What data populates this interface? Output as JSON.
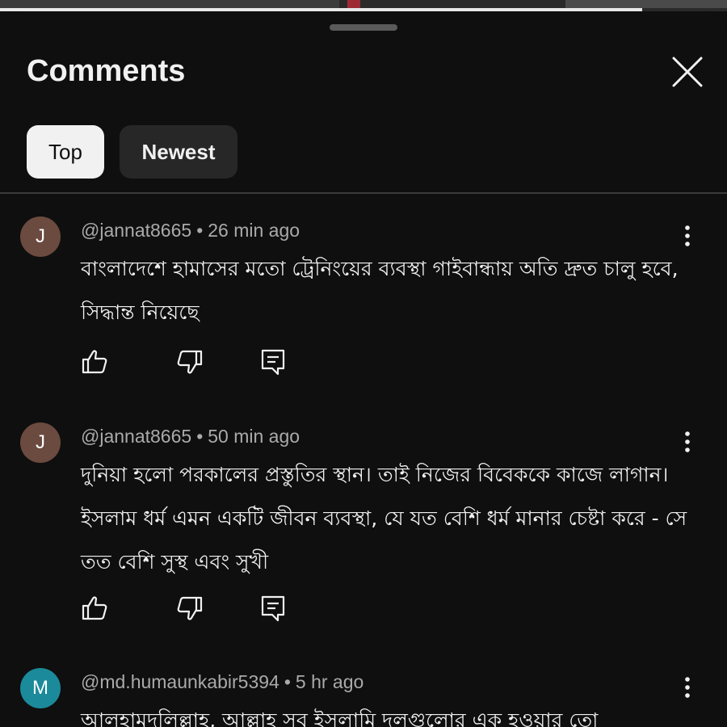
{
  "header": {
    "title": "Comments",
    "close_icon": "close-icon"
  },
  "sort": {
    "top_label": "Top",
    "newest_label": "Newest",
    "selected": "Top"
  },
  "colors": {
    "background": "#0f0f0f",
    "text": "#f1f1f1",
    "meta": "#aaaaaa",
    "chip_active_bg": "#f1f1f1",
    "chip_inactive_bg": "#272727"
  },
  "comments": [
    {
      "avatar_letter": "J",
      "avatar_color": "#6b4a3f",
      "handle": "@jannat8665",
      "time": "26 min ago",
      "text": "বাংলাদেশে হামাসের মতো ট্রেনিংয়ের ব্যবস্থা গাইবান্ধায় অতি দ্রুত চালু হবে, সিদ্ধান্ত নিয়েছে"
    },
    {
      "avatar_letter": "J",
      "avatar_color": "#6b4a3f",
      "handle": "@jannat8665",
      "time": "50 min ago",
      "text": "দুনিয়া হলো পরকালের প্রস্তুতির স্থান। তাই নিজের বিবেককে কাজে লাগান। ইসলাম ধর্ম এমন একটি জীবন ব্যবস্থা, যে যত বেশি ধর্ম মানার চেষ্টা করে - সে তত বেশি সুস্থ এবং সুখী"
    },
    {
      "avatar_letter": "M",
      "avatar_color": "#1b8a9a",
      "handle": "@md.humaunkabir5394",
      "time": "5 hr ago",
      "text": "আলহামদুলিল্লাহ, আল্লাহ সব ইসলামি দলগুলোর এক হওয়ার তো"
    }
  ],
  "separator": "•"
}
